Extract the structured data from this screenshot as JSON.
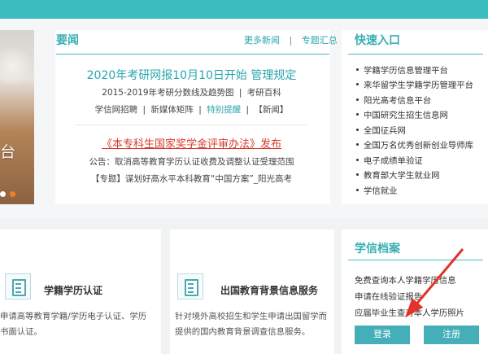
{
  "colors": {
    "accent": "#3bbdbf",
    "link": "#2aa6ad",
    "red": "#d33b2e",
    "button": "#44afb8"
  },
  "hero": {
    "visible_text": "台"
  },
  "news": {
    "title": "要闻",
    "more": "更多新闻",
    "separator": "|",
    "topic_summary": "专题汇总",
    "headline": "2020年考研网报10月10日开始 管理规定",
    "line1_text": "2015-2019年考研分数线及趋势图",
    "line1_separator": "|",
    "line1_link": "考研百科",
    "line2_a": "学信网招聘",
    "line2_b": "新媒体矩阵",
    "line2_c": "特别提醒",
    "line2_d": "【新闻】",
    "red_headline": "《本专科生国家奖学金评审办法》发布",
    "notice": "公告：取消高等教育学历认证收费及调整认证受理范围",
    "topic": "【专题】谋划好高水平本科教育“中国方案”_阳光高考"
  },
  "quick_entry": {
    "title": "快速入口",
    "items": [
      "学籍学历信息管理平台",
      "来华留学生学籍学历管理平台",
      "阳光高考信息平台",
      "中国研究生招生信息网",
      "全国征兵网",
      "全国万名优秀创新创业导师库",
      "电子成绩单验证",
      "教育部大学生就业网",
      "学信就业"
    ]
  },
  "features": {
    "card1_title": "学籍学历认证",
    "card1_desc_1": "申请高等教育学籍/学历电子认证、学历",
    "card1_desc_2": "书面认证。",
    "card2_title": "出国教育背景信息服务",
    "card2_desc_1": "针对境外高校招生和学生申请出国留学而",
    "card2_desc_2": "提供的国内教育背景调查信息服务。"
  },
  "archive": {
    "title": "学信档案",
    "line1": "免费查询本人学籍学历信息",
    "line2": "申请在线验证报告",
    "line3": "应届毕业生查对本人学历照片",
    "login": "登录",
    "register": "注册"
  }
}
